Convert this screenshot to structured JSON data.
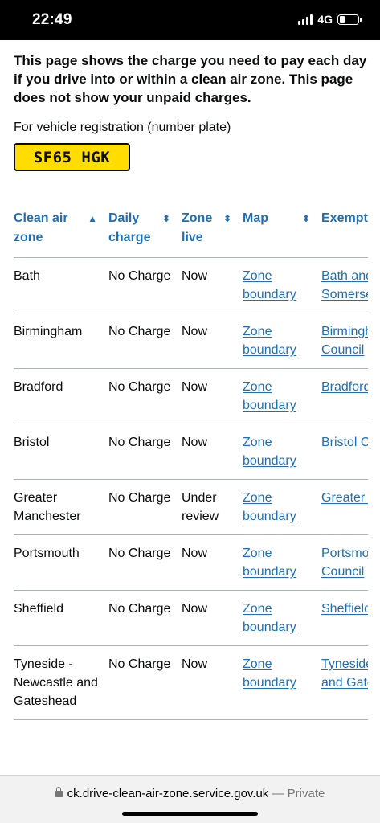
{
  "status": {
    "time": "22:49",
    "network": "4G"
  },
  "intro": "This page shows the charge you need to pay each day if you drive into or within a clean air zone. This page does not show your unpaid charges.",
  "registration": {
    "label": "For vehicle registration (number plate)",
    "plate": "SF65 HGK"
  },
  "table": {
    "headers": [
      {
        "label": "Clean air zone",
        "sort": "▲"
      },
      {
        "label": "Daily charge",
        "sort": "⬍"
      },
      {
        "label": "Zone live",
        "sort": "⬍"
      },
      {
        "label": "Map",
        "sort": "⬍"
      },
      {
        "label": "Exemptions",
        "sort": ""
      }
    ],
    "rows": [
      {
        "zone": "Bath",
        "charge": "No Charge",
        "live": "Now",
        "map": "Zone boundary",
        "exempt": "Bath and North East Somerset Council"
      },
      {
        "zone": "Birmingham",
        "charge": "No Charge",
        "live": "Now",
        "map": "Zone boundary",
        "exempt": "Birmingham City Council"
      },
      {
        "zone": "Bradford",
        "charge": "No Charge",
        "live": "Now",
        "map": "Zone boundary",
        "exempt": "Bradford Council"
      },
      {
        "zone": "Bristol",
        "charge": "No Charge",
        "live": "Now",
        "map": "Zone boundary",
        "exempt": "Bristol Council"
      },
      {
        "zone": "Greater Manchester",
        "charge": "No Charge",
        "live": "Under review",
        "map": "Zone boundary",
        "exempt": "Greater Manchester"
      },
      {
        "zone": "Portsmouth",
        "charge": "No Charge",
        "live": "Now",
        "map": "Zone boundary",
        "exempt": "Portsmouth City Council"
      },
      {
        "zone": "Sheffield",
        "charge": "No Charge",
        "live": "Now",
        "map": "Zone boundary",
        "exempt": "Sheffield Council"
      },
      {
        "zone": "Tyneside - Newcastle and Gateshead",
        "charge": "No Charge",
        "live": "Now",
        "map": "Zone boundary",
        "exempt": "Tyneside Newcastle and Gateshead"
      }
    ]
  },
  "url_bar": {
    "url": "ck.drive-clean-air-zone.service.gov.uk",
    "private": "— Private"
  }
}
